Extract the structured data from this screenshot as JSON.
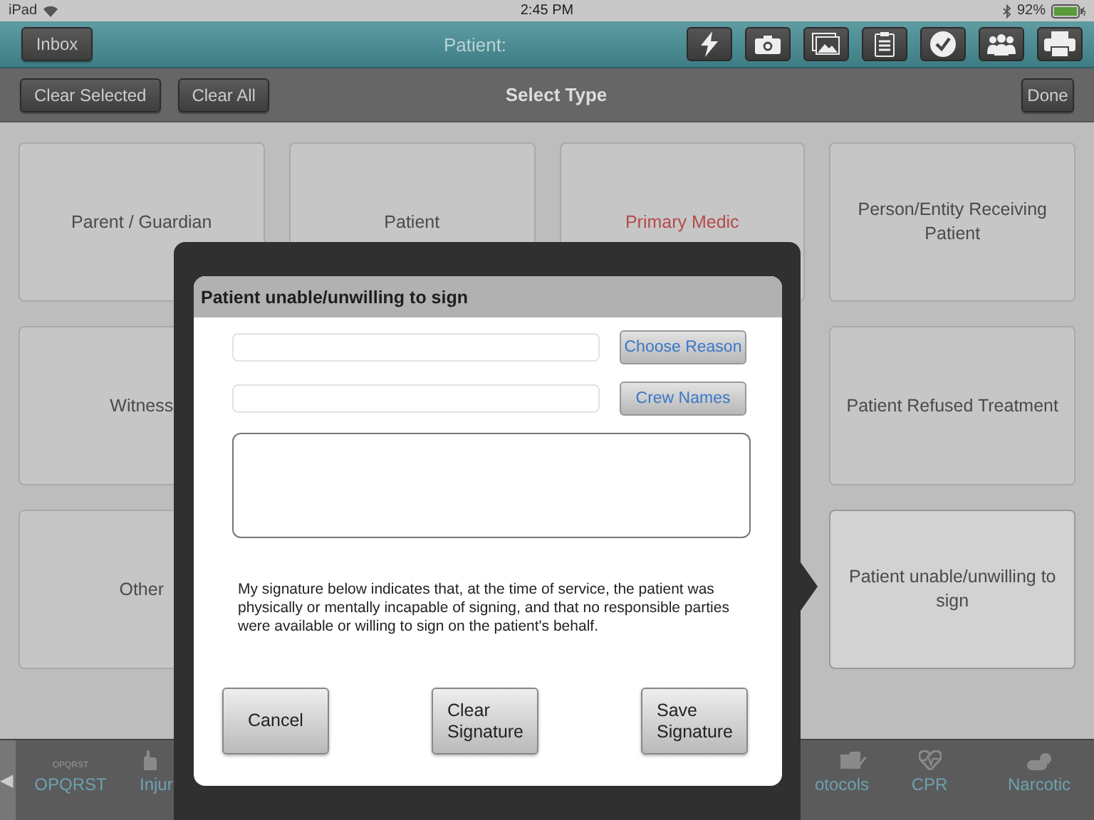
{
  "status_bar": {
    "device": "iPad",
    "time": "2:45 PM",
    "battery": "92%"
  },
  "toolbar": {
    "inbox_button": "Inbox",
    "title": "Patient:",
    "icons": [
      {
        "kind": "lightning"
      },
      {
        "kind": "camera"
      },
      {
        "kind": "gallery"
      },
      {
        "kind": "clipboard"
      },
      {
        "kind": "check"
      },
      {
        "kind": "people"
      },
      {
        "kind": "printer"
      }
    ]
  },
  "sub_bar": {
    "buttons": [
      "Clear Selected",
      "Clear All"
    ],
    "title": "Select Type",
    "done_button": "Done"
  },
  "tiles": [
    [
      {
        "label": "Parent / Guardian",
        "required": false,
        "selected": false
      },
      {
        "label": "Patient",
        "required": false,
        "selected": false
      },
      {
        "label": "Primary Medic",
        "required": true,
        "selected": false
      },
      {
        "label": "Person/Entity Receiving Patient",
        "required": false,
        "selected": false
      }
    ],
    [
      {
        "label": "Witness",
        "required": false,
        "selected": false
      },
      {
        "label": "Patient Refused Treatment",
        "required": false,
        "selected": false
      }
    ],
    [
      {
        "label": "Other",
        "required": false,
        "selected": false
      },
      {
        "label": "Patient unable/unwilling to sign",
        "required": false,
        "selected": true
      }
    ]
  ],
  "tab_bar": {
    "back_arrow": "◀",
    "leading": [
      {
        "kind": "opqrst",
        "icon_text": "OPQRST",
        "label": "OPQRST"
      },
      {
        "kind": "injury",
        "label": "Injur"
      }
    ],
    "trailing": [
      {
        "kind": "protocols",
        "label": "otocols"
      },
      {
        "kind": "cpr",
        "label": "CPR"
      },
      {
        "kind": "narcotic",
        "label": "Narcotic"
      }
    ]
  },
  "dialog": {
    "title": "Patient unable/unwilling to sign",
    "field_rows": [
      {
        "button": "Choose Reason"
      },
      {
        "button": "Crew Names"
      }
    ],
    "statement": "My signature below indicates that, at the time of service, the patient was physically or mentally incapable of signing, and that no responsible parties were available or willing to sign on the patient's behalf.",
    "buttons": [
      {
        "kind": "cancel",
        "label": "Cancel"
      },
      {
        "kind": "clear",
        "label": "Clear Signature"
      },
      {
        "kind": "save",
        "label": "Save Signature"
      }
    ]
  }
}
